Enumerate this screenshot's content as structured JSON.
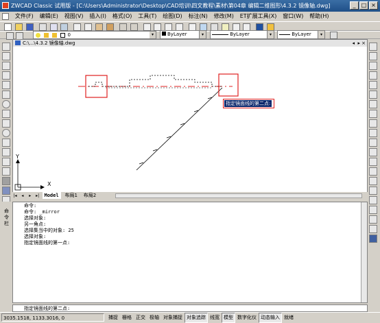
{
  "window": {
    "title": "ZWCAD Classic 试用版 - [C:\\Users\\Administrator\\Desktop\\CAD培训\\四文教程\\素材\\第04章 编辑二维图形\\4.3.2 镜像轴.dwg]",
    "controls": [
      "_",
      "□",
      "×"
    ]
  },
  "menu": [
    "文件(F)",
    "编辑(E)",
    "视图(V)",
    "插入(I)",
    "格式(O)",
    "工具(T)",
    "绘图(D)",
    "标注(N)",
    "修改(M)",
    "ET扩展工具(X)",
    "窗口(W)",
    "帮助(H)"
  ],
  "layers": {
    "current_layer": "0",
    "color": "ByLayer",
    "linetype": "ByLayer",
    "lineweight": "ByLayer"
  },
  "document": {
    "tab_title": "C:\\...\\4.3.2 镜像轴.dwg"
  },
  "drawing": {
    "axis_x_label": "X",
    "axis_y_label": "Y",
    "tooltip": "指定镜面线的第二点:",
    "highlight_color": "#e02020",
    "accent_color": "#0a246a"
  },
  "layout_tabs": [
    "Model",
    "布局1",
    "布局2"
  ],
  "command_history": [
    "命令:",
    "命令:  _mirror",
    "选择对象:",
    "另一角点:",
    "选择集当中的对象: 25",
    "选择对象:",
    "指定镜面线的第一点:"
  ],
  "command_prompt": "指定镜面线的第二点:",
  "command_side_label": "命令栏",
  "status": {
    "coordinates": "3035.1518,  1133.3016,  0",
    "toggles": [
      {
        "label": "捕捉",
        "on": false
      },
      {
        "label": "栅格",
        "on": false
      },
      {
        "label": "正交",
        "on": false
      },
      {
        "label": "极轴",
        "on": false
      },
      {
        "label": "对象捕捉",
        "on": false
      },
      {
        "label": "对象追踪",
        "on": true
      },
      {
        "label": "线宽",
        "on": false
      },
      {
        "label": "模型",
        "on": true
      },
      {
        "label": "数字化仪",
        "on": false
      },
      {
        "label": "动态输入",
        "on": true
      },
      {
        "label": "就绪",
        "on": false
      }
    ]
  }
}
